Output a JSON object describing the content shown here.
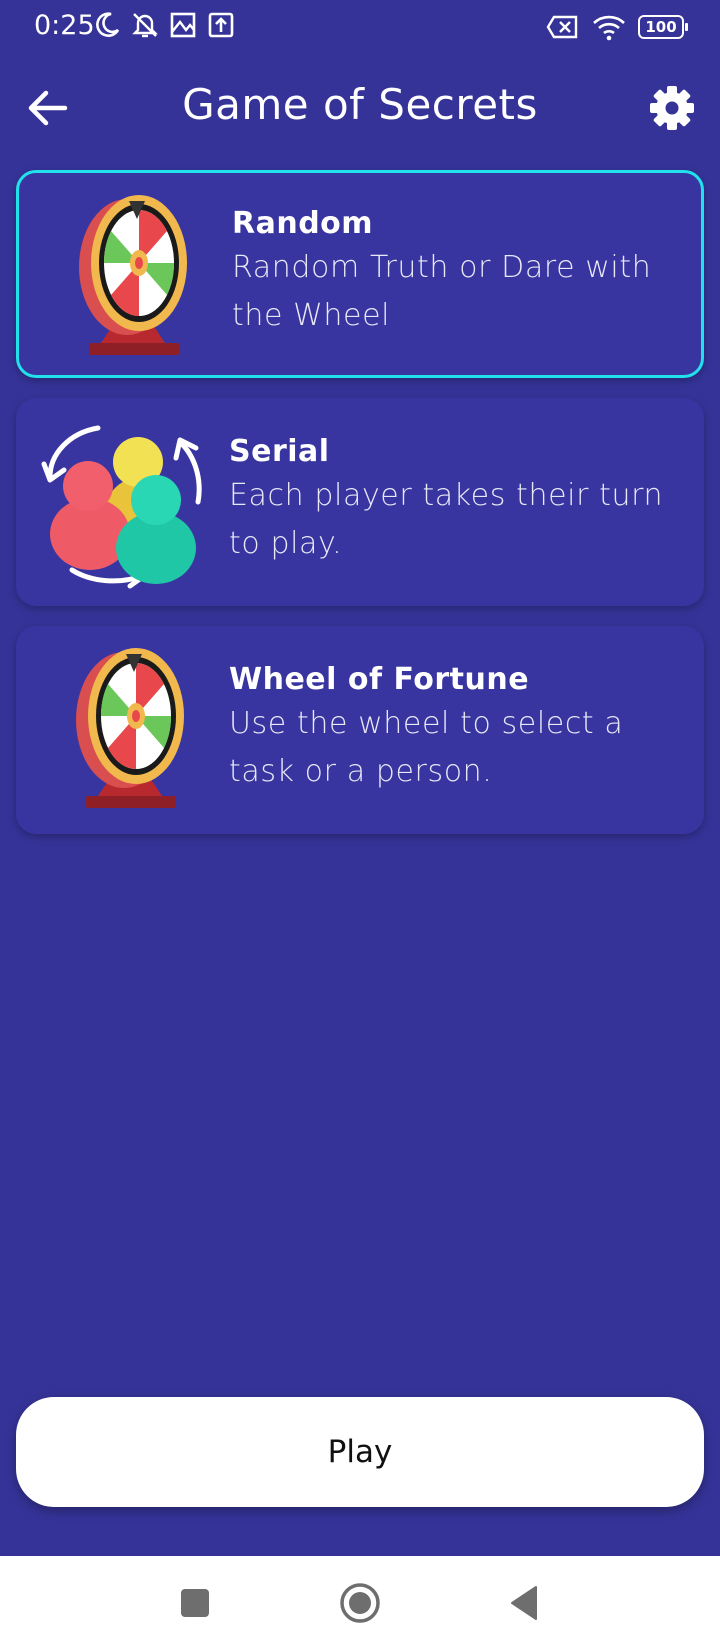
{
  "status_bar": {
    "time": "0:25",
    "left_icons": [
      "moon-icon",
      "alarm-off-icon",
      "image-icon",
      "upload-icon"
    ],
    "right_icons": [
      "no-sim-icon",
      "wifi-icon",
      "battery-icon"
    ],
    "battery": "100"
  },
  "app_bar": {
    "title": "Game of Secrets",
    "back_icon": "arrow-left-icon",
    "settings_icon": "gear-icon"
  },
  "modes": [
    {
      "title": "Random",
      "description": "Random Truth or Dare with the Wheel",
      "icon": "wheel-icon",
      "selected": true
    },
    {
      "title": "Serial",
      "description": "Each player takes their turn to play.",
      "icon": "players-rotate-icon",
      "selected": false
    },
    {
      "title": "Wheel of Fortune",
      "description": "Use the wheel to select a task or a person.",
      "icon": "wheel-icon",
      "selected": false
    }
  ],
  "play_button": {
    "label": "Play"
  },
  "nav_bar": {
    "buttons": [
      "recents-square-icon",
      "home-circle-icon",
      "back-triangle-icon"
    ]
  },
  "colors": {
    "background": "#353397",
    "card": "#3835a0",
    "selected_border": "#21e1ec",
    "button": "#ffffff"
  }
}
